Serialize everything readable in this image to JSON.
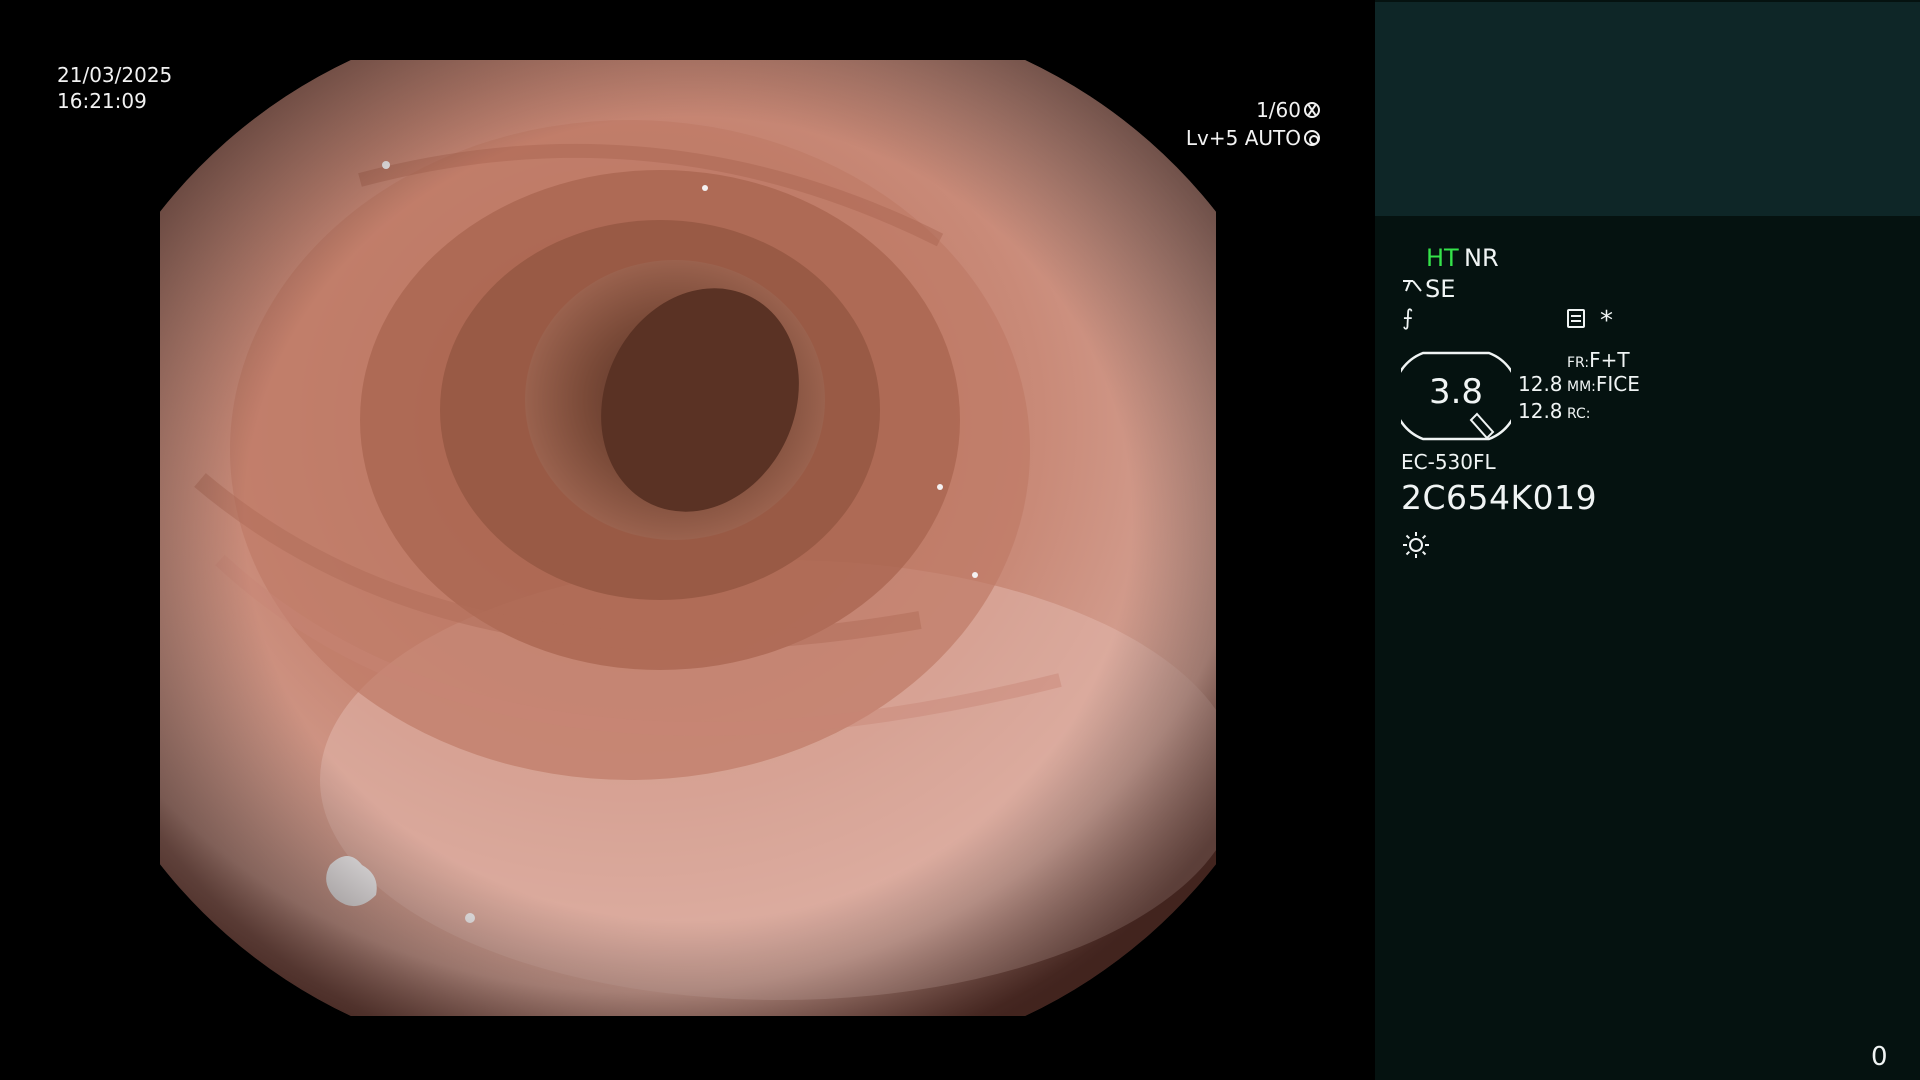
{
  "osd": {
    "date": "21/03/2025",
    "time": "16:21:09",
    "shutter": "1/60",
    "level": "Lv+5 AUTO"
  },
  "panel": {
    "ht": "HT",
    "nr": "NR",
    "se": "SE",
    "f_symbol": "⨍",
    "asterisk": "*",
    "gauge_value": "3.8",
    "value_1": "12.8",
    "value_2": "12.8",
    "fr_label": "FR:",
    "fr_value": "F+T",
    "mm_label": "MM:",
    "mm_value": "FICE",
    "rc_label": "RC:",
    "rc_value": "",
    "model": "EC-530FL",
    "serial": "2C654K019",
    "counter": "0"
  },
  "colors": {
    "ht_green": "#35e24a",
    "panel_bg": "#051210",
    "thumb_bg": "#0e2627"
  },
  "icons": [
    "shutter-icon",
    "iris-icon",
    "se-icon",
    "menu-icon",
    "light-icon"
  ]
}
